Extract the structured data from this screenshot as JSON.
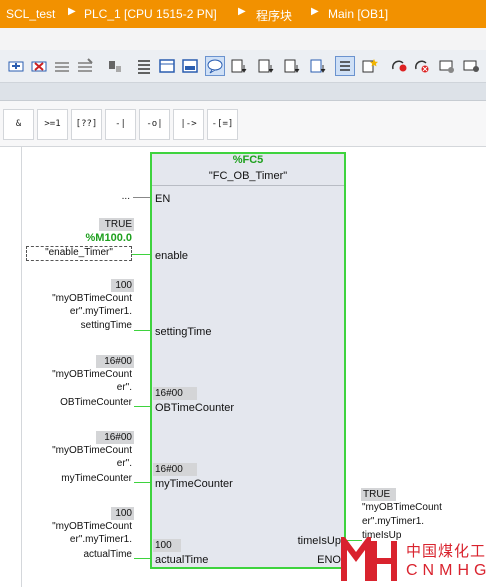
{
  "breadcrumb": [
    "SCL_test",
    "PLC_1 [CPU 1515-2 PN]",
    "程序块",
    "Main [OB1]"
  ],
  "instructions": [
    "&",
    ">=1",
    "[??]",
    "-|",
    "-o|",
    "|->",
    "-[=]"
  ],
  "toolbar_icons": [
    "network-insert-icon",
    "network-delete-icon",
    "network-icon-3",
    "network-icon-4",
    "tool-icon",
    "list-icon",
    "box-icon",
    "window-icon",
    "comment-icon",
    "favorites-icon-1",
    "favorites-icon-2",
    "favorites-icon-3",
    "favorites-icon-4",
    "list-view-icon",
    "star-icon",
    "goto-icon",
    "error-icon",
    "monitor-icon",
    "settings-icon"
  ],
  "block": {
    "db_label": "%FC5",
    "name": "\"FC_OB_Timer\"",
    "en_pin": "EN",
    "eno_pin": "ENO",
    "en_value": "...",
    "inputs": [
      {
        "pin": "enable",
        "status": "TRUE",
        "address": "%M100.0",
        "operand": "\"enable_Timer\""
      },
      {
        "pin": "settingTime",
        "status": "100",
        "operand_lines": [
          "\"myOBTimeCount",
          "er\".myTimer1.",
          "settingTime"
        ],
        "inner_value": ""
      },
      {
        "pin": "OBTimeCounter",
        "status": "16#00",
        "operand_lines": [
          "\"myOBTimeCount",
          "er\".",
          "OBTimeCounter"
        ],
        "inner_value": "16#00"
      },
      {
        "pin": "myTimeCounter",
        "status": "16#00",
        "operand_lines": [
          "\"myOBTimeCount",
          "er\".",
          "myTimeCounter"
        ],
        "inner_value": "16#00"
      },
      {
        "pin": "actualTime",
        "status": "100",
        "operand_lines": [
          "\"myOBTimeCount",
          "er\".myTimer1.",
          "actualTime"
        ],
        "inner_value": "100"
      }
    ],
    "outputs": [
      {
        "pin": "timeIsUp",
        "status": "TRUE",
        "operand_lines": [
          "\"myOBTimeCount",
          "er\".myTimer1.",
          "timeIsUp"
        ]
      }
    ]
  },
  "watermark": {
    "cn": "中国煤化工",
    "en": "CNMHG",
    "color": "#d9232e"
  }
}
